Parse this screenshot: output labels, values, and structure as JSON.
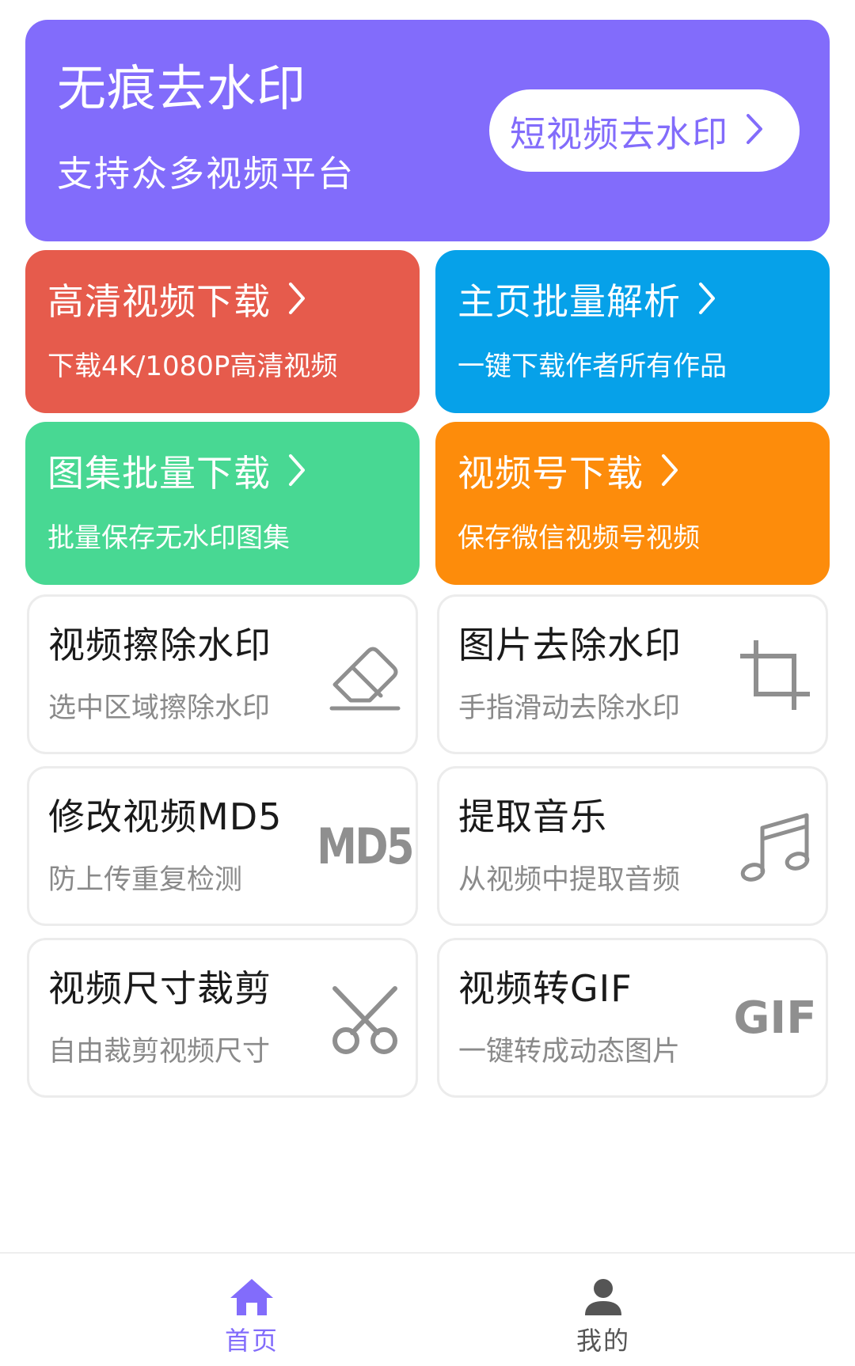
{
  "colors": {
    "primary": "#826cfb",
    "red": "#e65b4c",
    "blue": "#06a1e9",
    "green": "#48d893",
    "orange": "#fd8c0b",
    "icon_gray": "#8f8f8f",
    "nav_inactive": "#555555"
  },
  "hero": {
    "title": "无痕去水印",
    "subtitle": "支持众多视频平台",
    "button_label": "短视频去水印"
  },
  "features": [
    {
      "title": "高清视频下载",
      "subtitle": "下载4K/1080P高清视频",
      "color": "#e65b4c"
    },
    {
      "title": "主页批量解析",
      "subtitle": "一键下载作者所有作品",
      "color": "#06a1e9"
    },
    {
      "title": "图集批量下载",
      "subtitle": "批量保存无水印图集",
      "color": "#48d893"
    },
    {
      "title": "视频号下载",
      "subtitle": "保存微信视频号视频",
      "color": "#fd8c0b"
    }
  ],
  "tools": [
    {
      "title": "视频擦除水印",
      "subtitle": "选中区域擦除水印",
      "icon": "eraser-icon"
    },
    {
      "title": "图片去除水印",
      "subtitle": "手指滑动去除水印",
      "icon": "crop-icon"
    },
    {
      "title": "修改视频MD5",
      "subtitle": "防上传重复检测",
      "icon": "md5-icon",
      "icon_text": "MD5"
    },
    {
      "title": "提取音乐",
      "subtitle": "从视频中提取音频",
      "icon": "music-note-icon"
    },
    {
      "title": "视频尺寸裁剪",
      "subtitle": "自由裁剪视频尺寸",
      "icon": "scissors-icon"
    },
    {
      "title": "视频转GIF",
      "subtitle": "一键转成动态图片",
      "icon": "gif-icon",
      "icon_text": "GIF"
    }
  ],
  "nav": {
    "home_label": "首页",
    "mine_label": "我的",
    "active": "home"
  }
}
